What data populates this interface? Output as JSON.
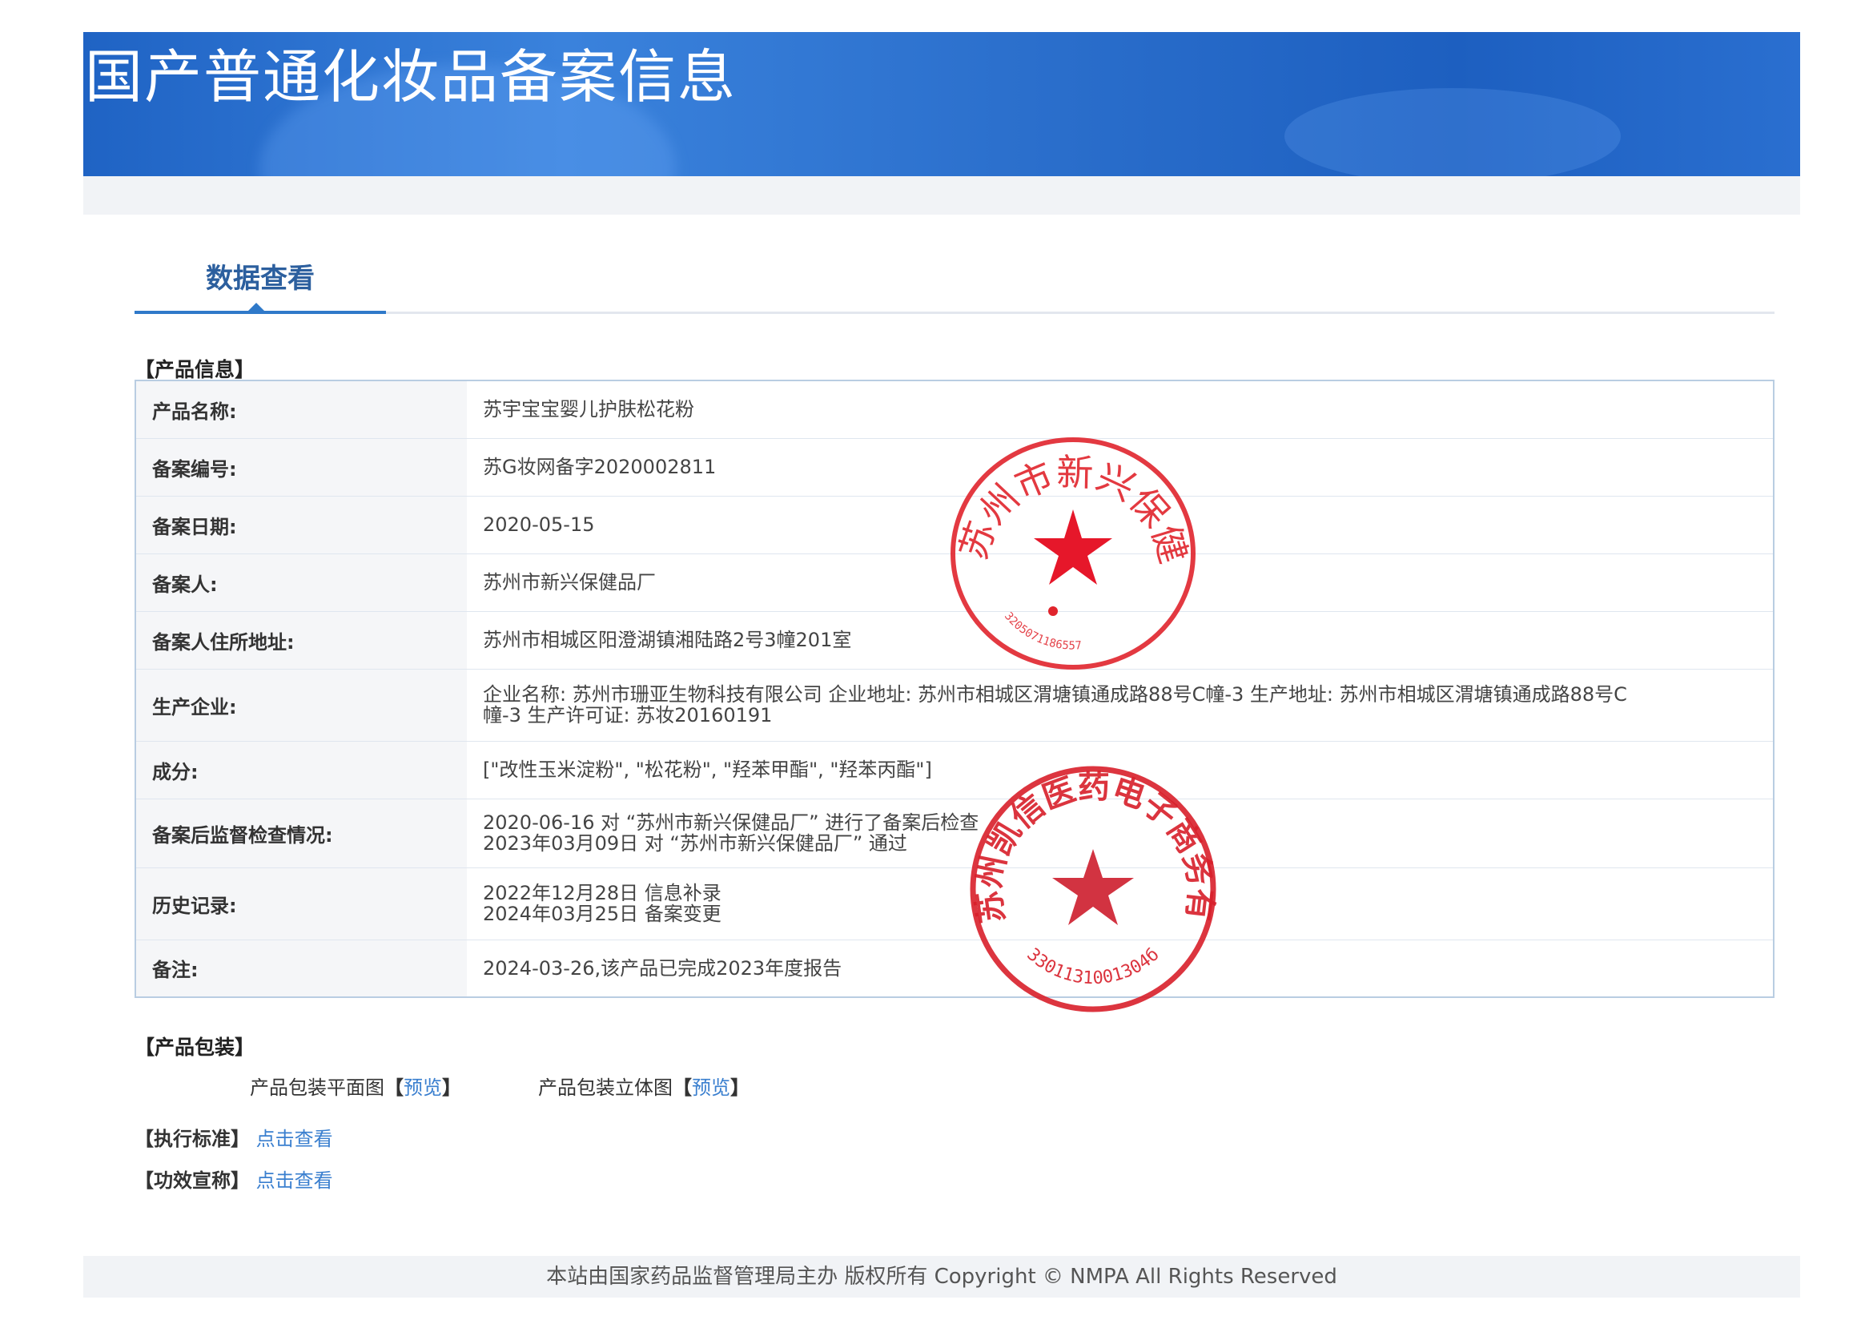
{
  "banner": {
    "title": "国产普通化妆品备案信息"
  },
  "tab": {
    "label": "数据查看"
  },
  "product_section": {
    "title": "【产品信息】"
  },
  "rows": [
    {
      "key": "产品名称:",
      "lines": [
        "苏宇宝宝婴儿护肤松花粉"
      ]
    },
    {
      "key": "备案编号:",
      "lines": [
        "苏G妆网备字2020002811"
      ]
    },
    {
      "key": "备案日期:",
      "lines": [
        "2020-05-15"
      ]
    },
    {
      "key": "备案人:",
      "lines": [
        "苏州市新兴保健品厂"
      ]
    },
    {
      "key": "备案人住所地址:",
      "lines": [
        "苏州市相城区阳澄湖镇湘陆路2号3幢201室"
      ]
    },
    {
      "key": "生产企业:",
      "lines": [
        "企业名称: 苏州市珊亚生物科技有限公司 企业地址: 苏州市相城区渭塘镇通成路88号C幢-3 生产地址: 苏州市相城区渭塘镇通成路88号C",
        "幢-3 生产许可证: 苏妆20160191"
      ]
    },
    {
      "key": "成分:",
      "lines": [
        "[\"改性玉米淀粉\", \"松花粉\", \"羟苯甲酯\", \"羟苯丙酯\"]"
      ]
    },
    {
      "key": "备案后监督检查情况:",
      "lines": [
        "2020-06-16 对 “苏州市新兴保健品厂” 进行了备案后检查",
        "2023年03月09日 对 “苏州市新兴保健品厂” 通过"
      ]
    },
    {
      "key": "历史记录:",
      "lines": [
        "2022年12月28日 信息补录",
        "2024年03月25日 备案变更"
      ]
    },
    {
      "key": "备注:",
      "lines": [
        "2024-03-26,该产品已完成2023年度报告"
      ]
    }
  ],
  "packaging": {
    "title": "【产品包装】",
    "flat_label": "产品包装平面图",
    "stereo_label": "产品包装立体图",
    "bracket_open": "【",
    "bracket_close": "】",
    "preview": "预览"
  },
  "standard": {
    "title": "【执行标准】",
    "link": "点击查看"
  },
  "efficacy": {
    "title": "【功效宣称】",
    "link": "点击查看"
  },
  "footer": {
    "text": "本站由国家药品监督管理局主办 版权所有 Copyright © NMPA All Rights Reserved"
  },
  "stamps": {
    "stamp1": {
      "text": "苏州市新兴保健品厂",
      "code": "3205071186557",
      "color": "#e0242c"
    },
    "stamp2": {
      "text": "苏州凯信医药电子商务有限公司",
      "code": "3301131001304б",
      "color": "#d81f2a"
    }
  }
}
